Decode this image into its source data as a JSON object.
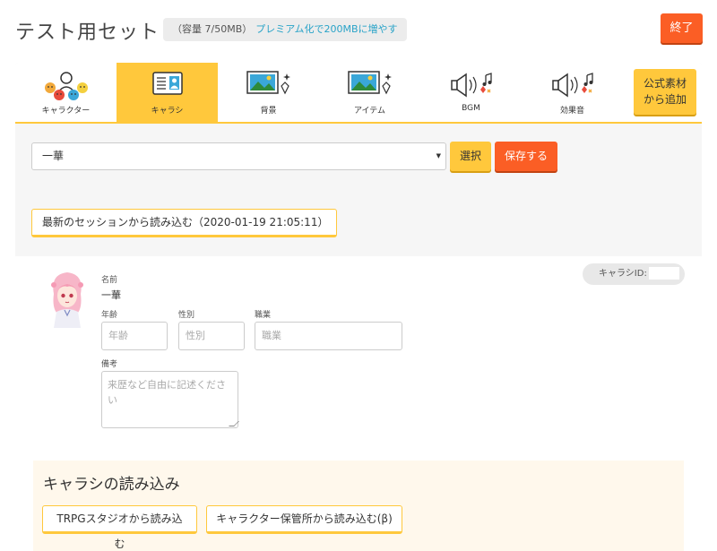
{
  "header": {
    "title": "テスト用セット",
    "storage_text": "（容量 7/50MB）",
    "premium_link": "プレミアム化で200MBに増やす",
    "end_label": "終了"
  },
  "tabs": [
    {
      "label": "キャラクター",
      "icon": "characters-icon",
      "active": false
    },
    {
      "label": "キャラシ",
      "icon": "character-sheet-icon",
      "active": true
    },
    {
      "label": "背景",
      "icon": "background-image-icon",
      "active": false
    },
    {
      "label": "アイテム",
      "icon": "item-image-icon",
      "active": false
    },
    {
      "label": "BGM",
      "icon": "bgm-speaker-icon",
      "active": false
    },
    {
      "label": "効果音",
      "icon": "sound-effect-speaker-icon",
      "active": false
    }
  ],
  "official_button": {
    "line1": "公式素材",
    "line2": "から追加"
  },
  "selector": {
    "selected": "一華",
    "select_label": "選択",
    "save_label": "保存する"
  },
  "load_session_label": "最新のセッションから読み込む（2020-01-19 21:05:11）",
  "character": {
    "id_label": "キャラシID:",
    "id_value": "",
    "name_label": "名前",
    "name_value": "一華",
    "age_label": "年齢",
    "age_placeholder": "年齢",
    "gender_label": "性別",
    "gender_placeholder": "性別",
    "job_label": "職業",
    "job_placeholder": "職業",
    "notes_label": "備考",
    "notes_placeholder": "来歴など自由に記述ください"
  },
  "import": {
    "title": "キャラシの読み込み",
    "trpg_studio_label": "TRPGスタジオから読み込む",
    "char_storage_label": "キャラクター保管所から読み込む(β)"
  },
  "colors": {
    "accent_yellow": "#ffc83c",
    "accent_orange": "#fb5e25",
    "link_blue": "#29a3c8"
  }
}
